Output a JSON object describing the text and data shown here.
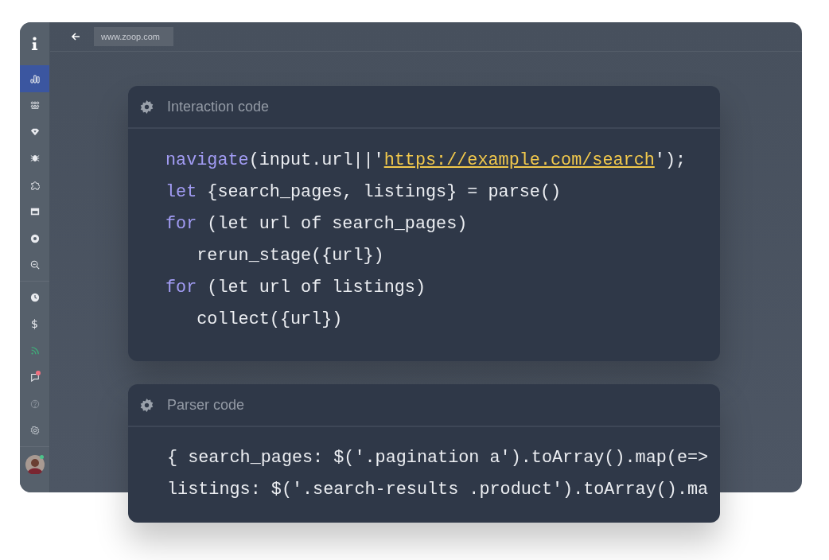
{
  "browser": {
    "url": "www.zoop.com"
  },
  "sidebar": {
    "items": [
      {
        "selected": true
      },
      {
        "selected": false
      },
      {
        "selected": false
      },
      {
        "selected": false
      },
      {
        "selected": false
      },
      {
        "selected": false
      },
      {
        "selected": false
      },
      {
        "selected": false
      },
      {
        "selected": false,
        "group_start": true
      },
      {
        "selected": false,
        "label": "$"
      },
      {
        "selected": false,
        "color": "#3fae7a"
      },
      {
        "selected": false,
        "badge": true
      },
      {
        "selected": false
      },
      {
        "selected": false
      }
    ]
  },
  "cards": [
    {
      "title": "Interaction code",
      "lines": [
        [
          {
            "text": "navigate",
            "kind": "keyword"
          },
          {
            "text": "(input.url||'",
            "kind": "plain"
          },
          {
            "text": "https://example.com/search",
            "kind": "string"
          },
          {
            "text": "');",
            "kind": "plain"
          }
        ],
        [
          {
            "text": "let",
            "kind": "keyword"
          },
          {
            "text": " {search_pages, listings} = parse()",
            "kind": "plain"
          }
        ],
        [
          {
            "text": "for",
            "kind": "keyword"
          },
          {
            "text": " (let url of search_pages)",
            "kind": "plain"
          }
        ],
        [
          {
            "text": "   rerun_stage({url})",
            "kind": "plain"
          }
        ],
        [
          {
            "text": "for",
            "kind": "keyword"
          },
          {
            "text": " (let url of listings)",
            "kind": "plain"
          }
        ],
        [
          {
            "text": "   collect({url})",
            "kind": "plain"
          }
        ]
      ]
    },
    {
      "title": "Parser code",
      "lines": [
        [
          {
            "text": "{ search_pages: $('.pagination a').toArray().map(e=>",
            "kind": "plain"
          }
        ],
        [
          {
            "text": "listings: $('.search-results .product').toArray().ma",
            "kind": "plain"
          }
        ]
      ]
    }
  ]
}
